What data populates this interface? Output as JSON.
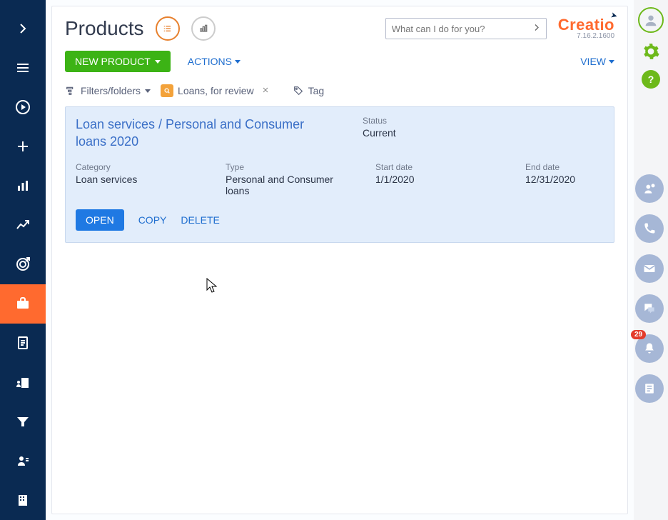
{
  "page": {
    "title": "Products"
  },
  "brand": {
    "name": "Creatio",
    "version": "7.16.2.1600"
  },
  "search": {
    "placeholder": "What can I do for you?"
  },
  "toolbar": {
    "new_label": "NEW PRODUCT",
    "actions_label": "ACTIONS",
    "view_label": "VIEW"
  },
  "filters": {
    "filtersfolders_label": "Filters/folders",
    "active_folder": "Loans, for review",
    "tag_label": "Tag"
  },
  "record": {
    "title": "Loan services / Personal and Consumer loans 2020",
    "status_label": "Status",
    "status_value": "Current",
    "category_label": "Category",
    "category_value": "Loan services",
    "type_label": "Type",
    "type_value": "Personal and Consumer loans",
    "start_label": "Start date",
    "start_value": "1/1/2020",
    "end_label": "End date",
    "end_value": "12/31/2020",
    "actions": {
      "open": "OPEN",
      "copy": "COPY",
      "delete": "DELETE"
    }
  },
  "notifications": {
    "count": "29"
  },
  "nav_items": [
    "expand",
    "menu",
    "run",
    "add",
    "columns-chart",
    "analytics",
    "target",
    "briefcase",
    "document",
    "org",
    "funnel",
    "user",
    "dept"
  ],
  "util": [
    "avatar",
    "gear",
    "help"
  ],
  "side_fabs": [
    "contact",
    "phone",
    "mail",
    "chat",
    "bell",
    "feed"
  ]
}
